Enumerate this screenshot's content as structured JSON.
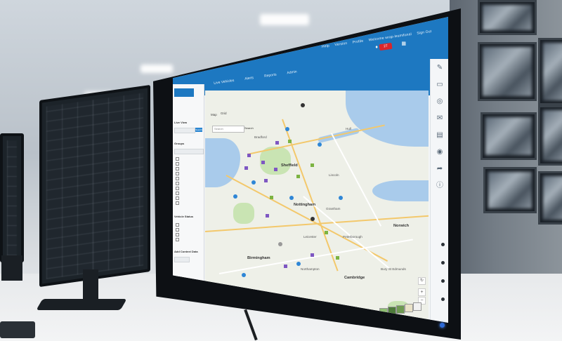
{
  "header": {
    "links": [
      "Help",
      "Version",
      "Profile",
      "Welcome wrap-lesmifunal",
      "Sign Out"
    ],
    "notification_count": "27"
  },
  "nav": {
    "items": [
      "Live Vehicles",
      "Alerts",
      "Reports",
      "Admin"
    ]
  },
  "sidebar": {
    "title": "Live View",
    "groups_label": "Groups",
    "search_button": "Search",
    "sections": [
      "Vehicle Status",
      "Add Context Data"
    ]
  },
  "map": {
    "tabs": [
      "Map",
      "Grid"
    ],
    "search_placeholder": "Search",
    "search_button": "Search",
    "places": {
      "sheffield": "Sheffield",
      "lincoln": "Lincoln",
      "nottingham": "Nottingham",
      "birmingham": "Birmingham",
      "peterborough": "Peterborough",
      "norwich": "Norwich",
      "cambridge": "Cambridge",
      "bury_st_edmunds": "Bury St Edmunds",
      "northampton": "Northampton",
      "chelmsford": "Chelmsford",
      "grantham": "Grantham",
      "leicester": "Leicester",
      "bradford": "Bradford",
      "hull": "Hull"
    },
    "attribution": "Map data ©2018 Google"
  },
  "colors": {
    "brand_blue": "#1d78c1",
    "alert_red": "#d9252b",
    "sea": "#a9cbeb",
    "land": "#eef0e8",
    "road": "#f3c86b"
  }
}
